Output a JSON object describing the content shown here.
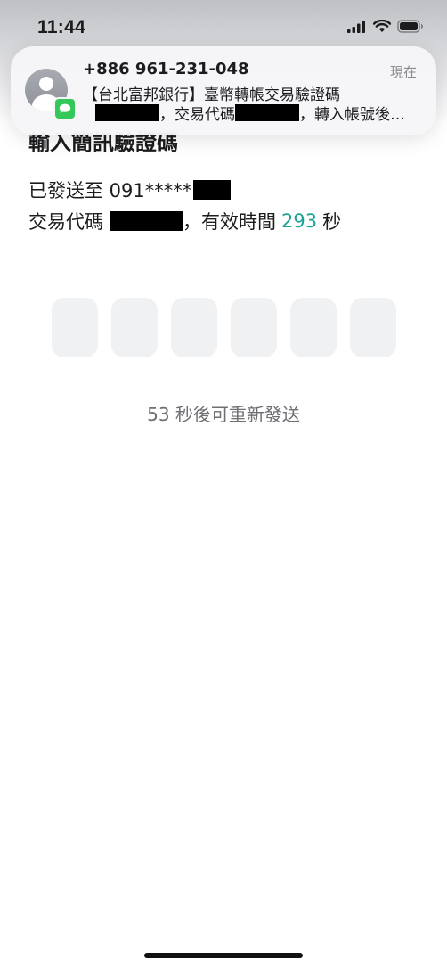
{
  "status_bar": {
    "time": "11:44",
    "icons": [
      "cellular-signal-icon",
      "wifi-icon",
      "battery-icon"
    ]
  },
  "page": {
    "title": "輸入簡訊驗證碼",
    "sent_prefix": "已發送至 091*****",
    "code_prefix": "交易代碼",
    "validity_prefix": "，有效時間",
    "countdown_seconds": "293",
    "seconds_unit": "秒",
    "otp_box_count": 6,
    "resend_text": "53 秒後可重新發送"
  },
  "notification": {
    "sender": "+886 961-231-048",
    "time": "現在",
    "line1": "【台北富邦銀行】臺幣轉帳交易驗證碼",
    "line2_mid": "，交易代碼",
    "line2_end": "，轉入帳號後…",
    "app_icon": "messages-icon",
    "avatar_icon": "contact-avatar-icon"
  },
  "colors": {
    "accent": "#1aa394",
    "messages_green": "#34c759"
  }
}
